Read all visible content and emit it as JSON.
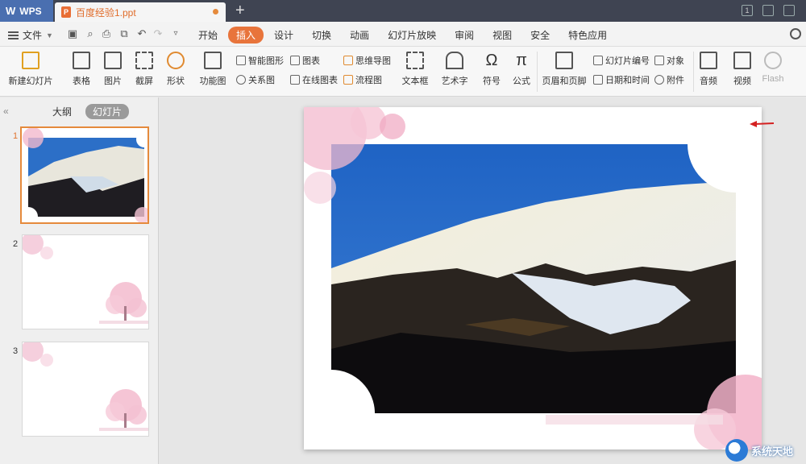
{
  "titlebar": {
    "app_name": "WPS",
    "doc_tab_title": "百度经验1.ppt",
    "new_tab_symbol": "+",
    "page_indicator": "1"
  },
  "menu": {
    "file_label": "文件",
    "tabs": [
      {
        "label": "开始",
        "active": false
      },
      {
        "label": "插入",
        "active": true
      },
      {
        "label": "设计",
        "active": false
      },
      {
        "label": "切换",
        "active": false
      },
      {
        "label": "动画",
        "active": false
      },
      {
        "label": "幻灯片放映",
        "active": false
      },
      {
        "label": "审阅",
        "active": false
      },
      {
        "label": "视图",
        "active": false
      },
      {
        "label": "安全",
        "active": false
      },
      {
        "label": "特色应用",
        "active": false
      }
    ],
    "accent_color": "#e8743b"
  },
  "ribbon": {
    "new_slide": "新建幻灯片",
    "table": "表格",
    "picture": "图片",
    "screenshot": "截屏",
    "shape": "形状",
    "function_chart": "功能图",
    "smart_graphic": "智能图形",
    "chart": "图表",
    "relation_chart": "关系图",
    "online_chart": "在线图表",
    "mind_map": "思维导图",
    "flowchart": "流程图",
    "textbox": "文本框",
    "wordart": "艺术字",
    "symbol": "符号",
    "formula": "公式",
    "header_footer": "页眉和页脚",
    "slide_number": "幻灯片编号",
    "date_time": "日期和时间",
    "object": "对象",
    "attachment": "附件",
    "audio": "音频",
    "video": "视频",
    "flash": "Flash"
  },
  "panel": {
    "outline_tab": "大纲",
    "slides_tab": "幻灯片",
    "slides": [
      {
        "number": "1",
        "selected": true
      },
      {
        "number": "2",
        "selected": false
      },
      {
        "number": "3",
        "selected": false
      }
    ]
  },
  "watermark": {
    "text": "系统天地"
  }
}
